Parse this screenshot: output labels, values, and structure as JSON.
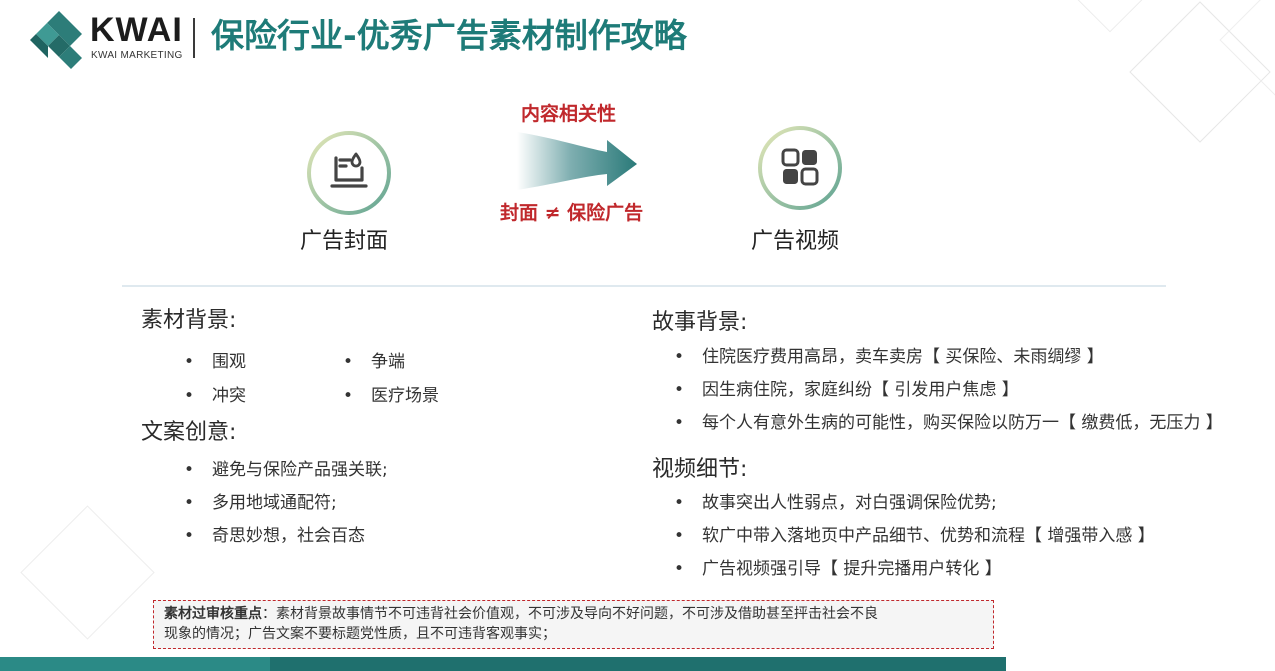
{
  "header": {
    "brand_name": "KWAI",
    "brand_sub": "KWAI MARKETING",
    "title": "保险行业-优秀广告素材制作攻略"
  },
  "flow": {
    "left_label": "广告封面",
    "left_icon": "document-stack-icon",
    "right_label": "广告视频",
    "right_icon": "app-grid-icon",
    "arrow_top": "内容相关性",
    "arrow_bottom": "封面 ≠ 保险广告",
    "accent_color": "#c0282c",
    "brand_color": "#1e7b78"
  },
  "left": {
    "background_heading": "素材背景:",
    "background_items": [
      "围观",
      "争端",
      "冲突",
      "医疗场景"
    ],
    "copy_heading": "文案创意:",
    "copy_items": [
      "避免与保险产品强关联;",
      "多用地域通配符;",
      "奇思妙想，社会百态"
    ]
  },
  "right": {
    "story_heading": "故事背景:",
    "story_items": [
      "住院医疗费用高昂，卖车卖房【 买保险、未雨绸缪 】",
      "因生病住院，家庭纠纷【 引发用户焦虑 】",
      "每个人有意外生病的可能性，购买保险以防万一【 缴费低，无压力 】"
    ],
    "video_heading": "视频细节:",
    "video_items": [
      "故事突出人性弱点，对白强调保险优势;",
      "软广中带入落地页中产品细节、优势和流程【 增强带入感 】",
      "广告视频强引导【 提升完播用户转化 】"
    ]
  },
  "note": {
    "label": "素材过审核重点",
    "line1": "：素材背景故事情节不可违背社会价值观，不可涉及导向不好问题，不可涉及借助甚至抨击社会不良",
    "line2": "现象的情况；广告文案不要标题党性质，且不可违背客观事实；"
  }
}
